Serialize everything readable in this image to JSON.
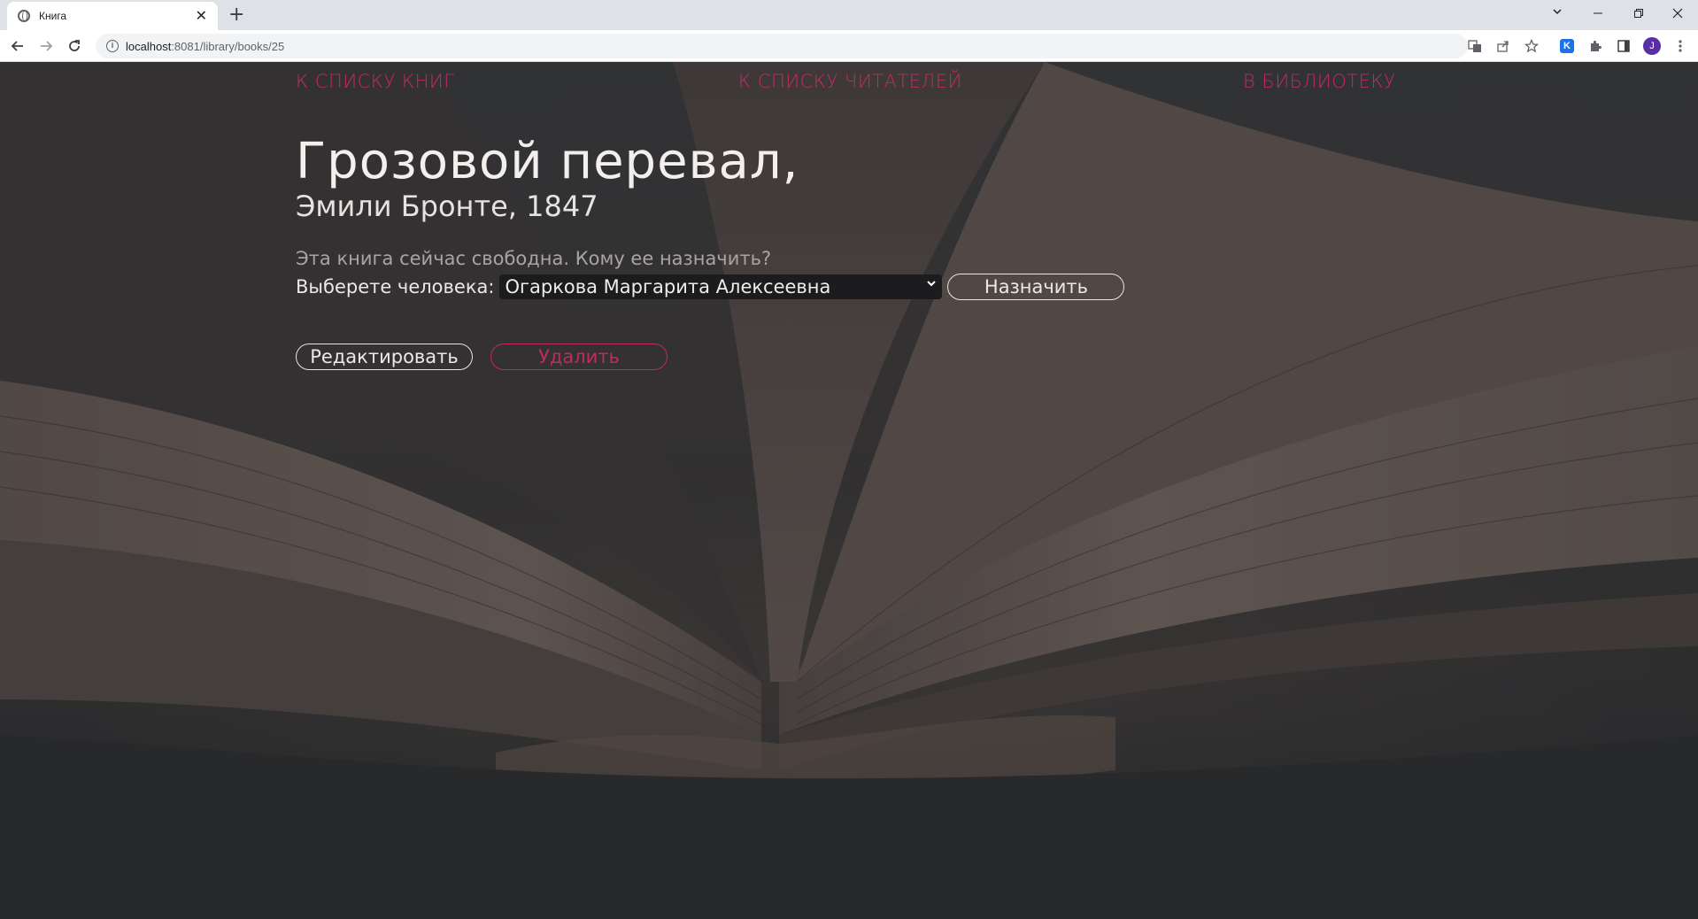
{
  "browser": {
    "tab_title": "Книга",
    "tab_close": "✕",
    "new_tab": "+",
    "url_host": "localhost",
    "url_path": ":8081/library/books/25",
    "window_controls": [
      "⌄",
      "–",
      "❐",
      "✕"
    ],
    "avatar_letter": "J",
    "extension_letter": "K"
  },
  "nav": {
    "books_link": "К СПИСКУ КНИГ",
    "readers_link": "К СПИСКУ ЧИТАТЕЛЕЙ",
    "library_link": "В БИБЛИОТЕКУ"
  },
  "book": {
    "title": "Грозовой перевал,",
    "author": "Эмили Бронте",
    "year": "1847"
  },
  "assign": {
    "status_text": "Эта книга сейчас свободна. Кому ее назначить?",
    "select_label": "Выберете человека:",
    "selected_person": "Огаркова Маргарита Алексеевна",
    "assign_button": "Назначить"
  },
  "actions": {
    "edit_button": "Редактировать",
    "delete_button": "Удалить"
  },
  "colors": {
    "accent": "#c22a5e",
    "text": "#f2efed",
    "muted": "#a9a4a2"
  }
}
